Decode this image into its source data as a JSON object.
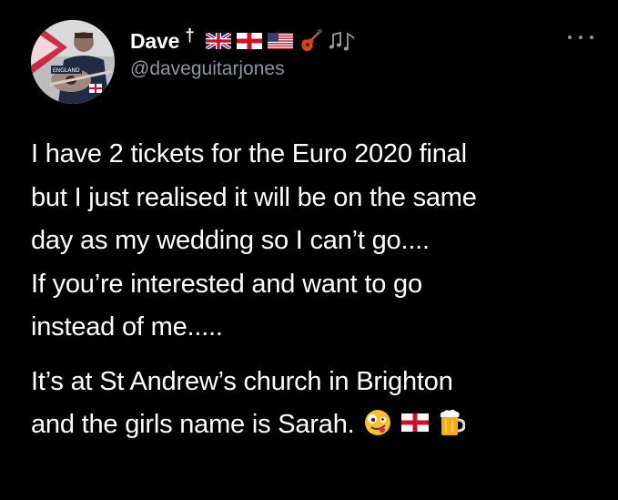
{
  "author": {
    "display_name": "Dave",
    "name_symbol": "†",
    "handle": "@daveguitarjones",
    "name_icons": [
      "uk-flag-icon",
      "england-flag-icon",
      "us-flag-icon",
      "guitar-icon",
      "music-notes-icon"
    ],
    "avatar_shirt_text": "ENGLAND"
  },
  "tweet": {
    "lines": [
      "I have 2 tickets for the Euro 2020 final",
      "but I just realised it will be on the same",
      "day as my wedding so I can’t go....",
      "If you’re interested and want to go",
      "instead of me....."
    ],
    "lines2": [
      "It’s at St Andrew’s church in Brighton",
      "and the girls name is Sarah."
    ],
    "trailing_icons": [
      "zany-face-icon",
      "england-flag-icon",
      "beer-mug-icon"
    ]
  },
  "colors": {
    "background": "#000000",
    "text": "#ffffff",
    "secondary_text": "#8b98a5"
  }
}
